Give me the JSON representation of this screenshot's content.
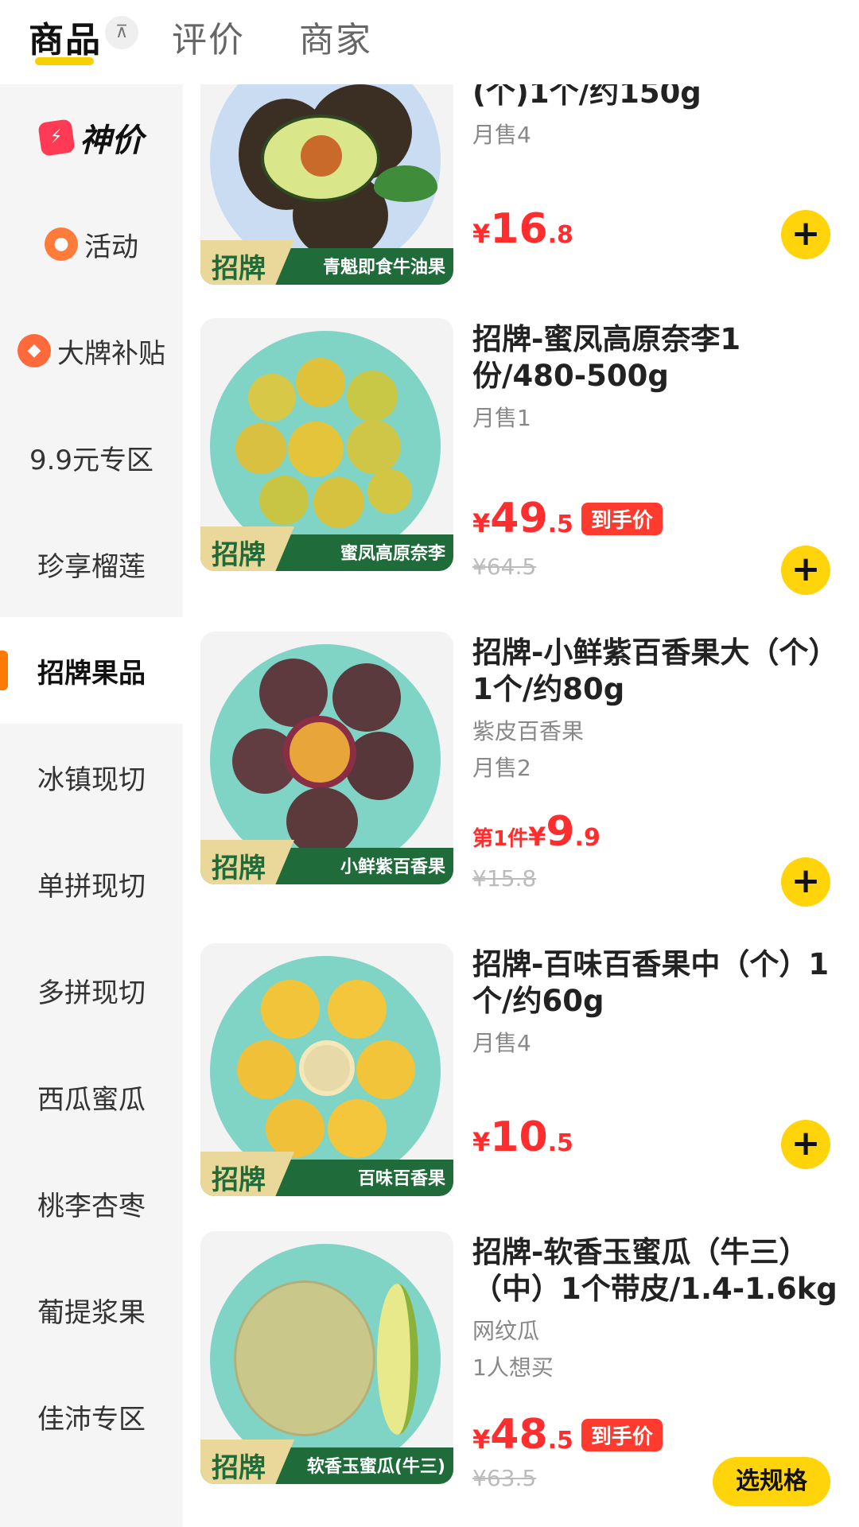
{
  "tabs": {
    "goods": "商品",
    "reviews": "评价",
    "merchant": "商家",
    "collapse_icon": "⊼"
  },
  "sidebar": {
    "items": [
      {
        "label": "神价",
        "icon": "lightning-icon"
      },
      {
        "label": "活动",
        "icon": "tag-icon"
      },
      {
        "label": "大牌补贴",
        "icon": "diamond-icon"
      },
      {
        "label": "9.9元专区"
      },
      {
        "label": "珍享榴莲"
      },
      {
        "label": "招牌果品",
        "active": true
      },
      {
        "label": "冰镇现切"
      },
      {
        "label": "单拼现切"
      },
      {
        "label": "多拼现切"
      },
      {
        "label": "西瓜蜜瓜"
      },
      {
        "label": "桃李杏枣"
      },
      {
        "label": "葡提浆果"
      },
      {
        "label": "佳沛专区"
      }
    ]
  },
  "products": [
    {
      "title": "(个)1个/约150g",
      "monthly_sales": "月售4",
      "price": {
        "yen": "¥",
        "int": "16",
        "dec": ".8"
      },
      "badge": {
        "brand": "招牌",
        "name": "青魁即食牛油果"
      },
      "action": "+"
    },
    {
      "title": "招牌-蜜凤高原奈李1份/480-500g",
      "monthly_sales": "月售1",
      "price": {
        "yen": "¥",
        "int": "49",
        "dec": ".5"
      },
      "tag": "到手价",
      "old_price": "¥64.5",
      "badge": {
        "brand": "招牌",
        "name": "蜜凤高原奈李"
      },
      "action": "+"
    },
    {
      "title": "招牌-小鲜紫百香果大（个）1个/约80g",
      "subtitle": "紫皮百香果",
      "monthly_sales": "月售2",
      "price": {
        "prefix": "第1件",
        "yen": "¥",
        "int": "9",
        "dec": ".9"
      },
      "old_price": "¥15.8",
      "badge": {
        "brand": "招牌",
        "name": "小鲜紫百香果"
      },
      "action": "+"
    },
    {
      "title": "招牌-百味百香果中（个）1个/约60g",
      "monthly_sales": "月售4",
      "price": {
        "yen": "¥",
        "int": "10",
        "dec": ".5"
      },
      "badge": {
        "brand": "招牌",
        "name": "百味百香果"
      },
      "action": "+"
    },
    {
      "title": "招牌-软香玉蜜瓜（牛三）（中）1个带皮/1.4-1.6kg",
      "subtitle": "网纹瓜",
      "monthly_sales": "1人想买",
      "price": {
        "yen": "¥",
        "int": "48",
        "dec": ".5"
      },
      "tag": "到手价",
      "old_price": "¥63.5",
      "badge": {
        "brand": "招牌",
        "name": "软香玉蜜瓜(牛三)"
      },
      "action": "选规格"
    }
  ],
  "colors": {
    "accent_yellow": "#ffd40a",
    "price_red": "#ff2d2d",
    "active_bar_orange": "#ff7a00",
    "badge_green": "#1f6b3a"
  }
}
